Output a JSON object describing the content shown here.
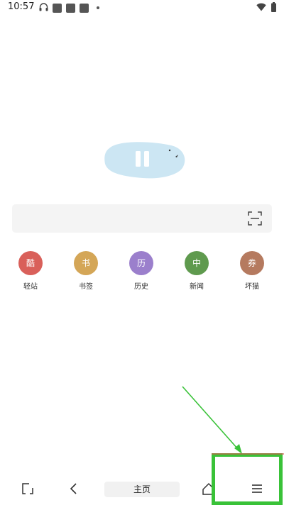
{
  "status_bar": {
    "time": "10:57"
  },
  "search": {
    "placeholder": ""
  },
  "shortcuts": [
    {
      "glyph": "酷",
      "label": "轻站",
      "color": "#d9605a"
    },
    {
      "glyph": "书",
      "label": "书签",
      "color": "#d4a657"
    },
    {
      "glyph": "历",
      "label": "历史",
      "color": "#9b7fcc"
    },
    {
      "glyph": "中",
      "label": "新闻",
      "color": "#5f9a4e"
    },
    {
      "glyph": "券",
      "label": "坏猫",
      "color": "#b57a5f"
    }
  ],
  "bottom_nav": {
    "home_label": "主页"
  },
  "colors": {
    "logo_bg": "#cce6f3",
    "highlight": "#39c238"
  }
}
